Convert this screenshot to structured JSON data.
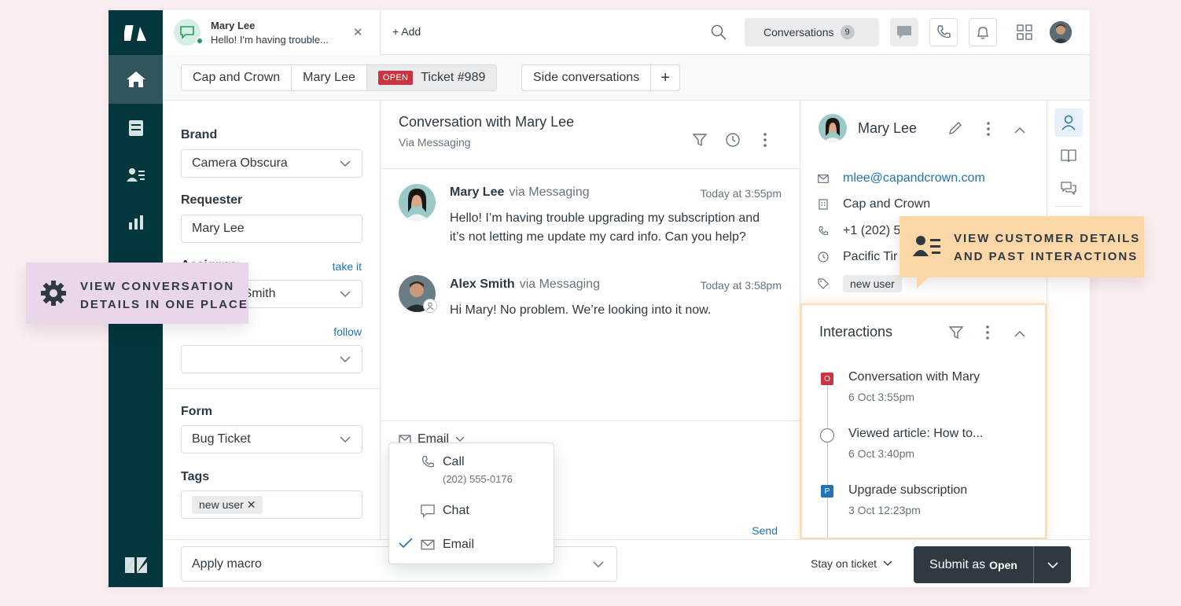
{
  "topbar": {
    "tab_name": "Mary Lee",
    "tab_preview": "Hello! I'm having trouble...",
    "add_label": "+ Add",
    "conversations_label": "Conversations",
    "conversations_count": "9"
  },
  "breadcrumb": {
    "brand": "Cap and Crown",
    "requester": "Mary Lee",
    "status_badge": "OPEN",
    "ticket": "Ticket #989",
    "side_conversations": "Side conversations",
    "add": "+"
  },
  "props": {
    "brand_label": "Brand",
    "brand_value": "Camera Obscura",
    "requester_label": "Requester",
    "requester_value": "Mary Lee",
    "assignee_label": "Assignee",
    "assignee_link": "take it",
    "assignee_value": "Alex Smith",
    "follow_link": "follow",
    "form_label": "Form",
    "form_value": "Bug Ticket",
    "tags_label": "Tags",
    "tag_value": "new user"
  },
  "conversation": {
    "title": "Conversation with Mary Lee",
    "subtitle": "Via Messaging",
    "messages": [
      {
        "name": "Mary Lee",
        "via": "via Messaging",
        "time": "Today at 3:55pm",
        "line1": "Hello! I’m having trouble upgrading my subscription and",
        "line2": "it’s not letting me update my card info. Can you help?"
      },
      {
        "name": "Alex Smith",
        "via": "via Messaging",
        "time": "Today at 3:58pm",
        "line1": "Hi Mary! No problem. We’re looking into it now."
      }
    ],
    "channel": "Email",
    "send": "Send"
  },
  "channel_menu": {
    "call_label": "Call",
    "call_number": "(202) 555-0176",
    "chat_label": "Chat",
    "email_label": "Email"
  },
  "customer": {
    "name": "Mary Lee",
    "email": "mlee@capandcrown.com",
    "org": "Cap and Crown",
    "phone": "+1 (202) 5",
    "timezone": "Pacific Tir",
    "tag": "new user"
  },
  "interactions": {
    "title": "Interactions",
    "items": [
      {
        "badge": "O",
        "title": "Conversation with Mary",
        "time": "6 Oct 3:55pm"
      },
      {
        "badge": "",
        "title": "Viewed article: How to...",
        "time": "6 Oct 3:40pm"
      },
      {
        "badge": "P",
        "title": "Upgrade subscription",
        "time": "3 Oct 12:23pm"
      }
    ]
  },
  "footer": {
    "macro": "Apply macro",
    "stay": "Stay on ticket",
    "submit": "Submit as",
    "submit_status": "Open"
  },
  "callouts": {
    "left_line1": "VIEW CONVERSATION",
    "left_line2": "DETAILS IN ONE PLACE",
    "right_line1": "VIEW CUSTOMER DETAILS",
    "right_line2": "AND PAST INTERACTIONS"
  },
  "colors": {
    "nav_bg": "#03363d",
    "open_badge": "#cc3340",
    "pending_badge": "#1f73b7",
    "link": "#1f73b7",
    "callout_left": "#e9d6ea",
    "callout_right": "#fbd6a6"
  }
}
